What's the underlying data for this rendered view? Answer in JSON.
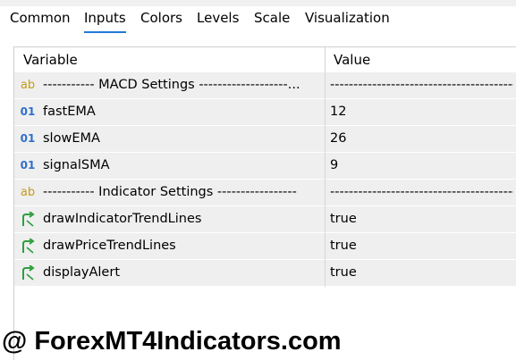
{
  "tabs": [
    {
      "label": "Common"
    },
    {
      "label": "Inputs",
      "active": true
    },
    {
      "label": "Colors"
    },
    {
      "label": "Levels"
    },
    {
      "label": "Scale"
    },
    {
      "label": "Visualization"
    }
  ],
  "table": {
    "headers": {
      "variable": "Variable",
      "value": "Value"
    },
    "rows": [
      {
        "icon": "ab-string-icon",
        "icon_text": "ab",
        "name": "----------- MACD Settings -------------------...",
        "value": "--------------------------------------------------"
      },
      {
        "icon": "int-icon",
        "icon_text": "01",
        "name": "fastEMA",
        "value": "12"
      },
      {
        "icon": "int-icon",
        "icon_text": "01",
        "name": "slowEMA",
        "value": "26"
      },
      {
        "icon": "int-icon",
        "icon_text": "01",
        "name": "signalSMA",
        "value": "9"
      },
      {
        "icon": "ab-string-icon",
        "icon_text": "ab",
        "name": "----------- Indicator Settings -----------------",
        "value": "--------------------------------------------------"
      },
      {
        "icon": "bool-arrow-icon",
        "icon_text": "",
        "name": "drawIndicatorTrendLines",
        "value": "true"
      },
      {
        "icon": "bool-arrow-icon",
        "icon_text": "",
        "name": "drawPriceTrendLines",
        "value": "true"
      },
      {
        "icon": "bool-arrow-icon",
        "icon_text": "",
        "name": "displayAlert",
        "value": "true"
      }
    ]
  },
  "watermark": "@ ForexMT4Indicators.com",
  "colors": {
    "accent_tab_underline": "#1f7bd6",
    "row_bg": "#efefef",
    "string_icon": "#c79a1a",
    "int_icon": "#2f6fc8",
    "bool_icon": "#2e9e3e"
  }
}
